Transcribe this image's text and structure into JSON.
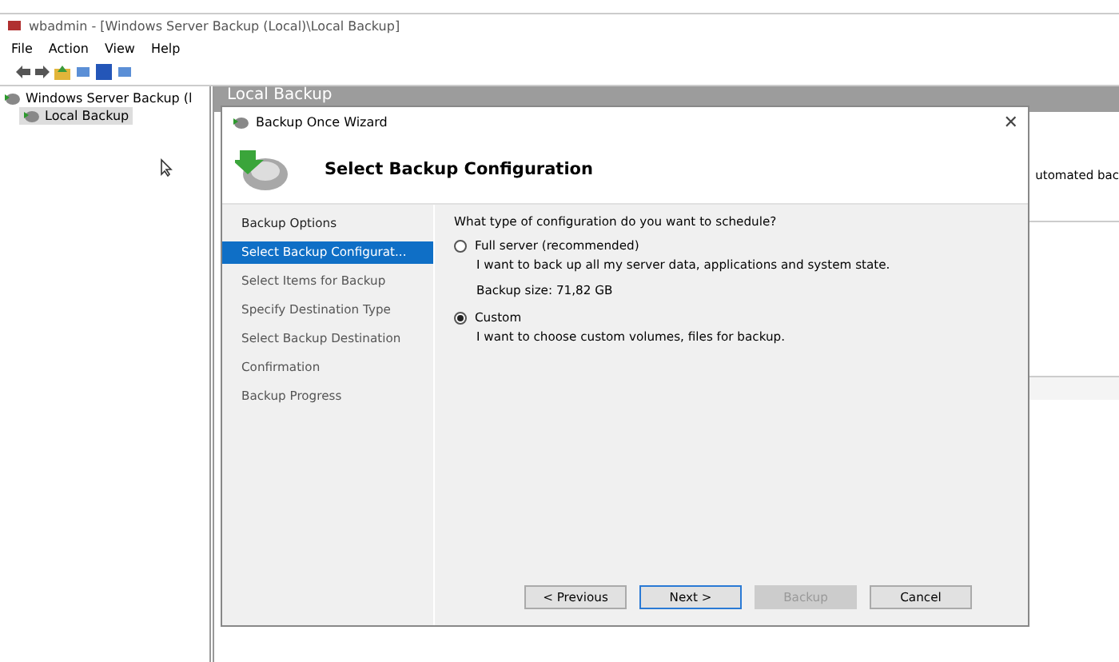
{
  "window": {
    "title": "wbadmin - [Windows Server Backup (Local)\\Local Backup]"
  },
  "menu": [
    "File",
    "Action",
    "View",
    "Help"
  ],
  "tree": [
    {
      "label": "Windows Server Backup (l",
      "selected": false,
      "children": [
        {
          "label": "Local Backup",
          "selected": true
        }
      ]
    }
  ],
  "pane": {
    "title": "Local Backup",
    "partial_text": "utomated bac"
  },
  "wizard": {
    "title": "Backup Once Wizard",
    "close": "✕",
    "heading": "Select Backup Configuration",
    "steps": [
      {
        "label": "Backup Options",
        "selected": false
      },
      {
        "label": "Select Backup Configurat...",
        "selected": true
      },
      {
        "label": "Select Items for Backup",
        "selected": false
      },
      {
        "label": "Specify Destination Type",
        "selected": false
      },
      {
        "label": "Select Backup Destination",
        "selected": false
      },
      {
        "label": "Confirmation",
        "selected": false
      },
      {
        "label": "Backup Progress",
        "selected": false
      }
    ],
    "question": "What type of configuration do you want to schedule?",
    "options": [
      {
        "label": "Full server (recommended)",
        "selected": false,
        "description": "I want to back up all my server data, applications and system state.",
        "note": "Backup size: 71,82 GB"
      },
      {
        "label": "Custom",
        "selected": true,
        "description": "I want to choose custom volumes, files for backup."
      }
    ],
    "buttons": [
      {
        "label": "< Previous",
        "disabled": false,
        "default": false
      },
      {
        "label": "Next >",
        "disabled": false,
        "default": true
      },
      {
        "label": "Backup",
        "disabled": true,
        "default": false
      },
      {
        "label": "Cancel",
        "disabled": false,
        "default": false
      }
    ]
  }
}
